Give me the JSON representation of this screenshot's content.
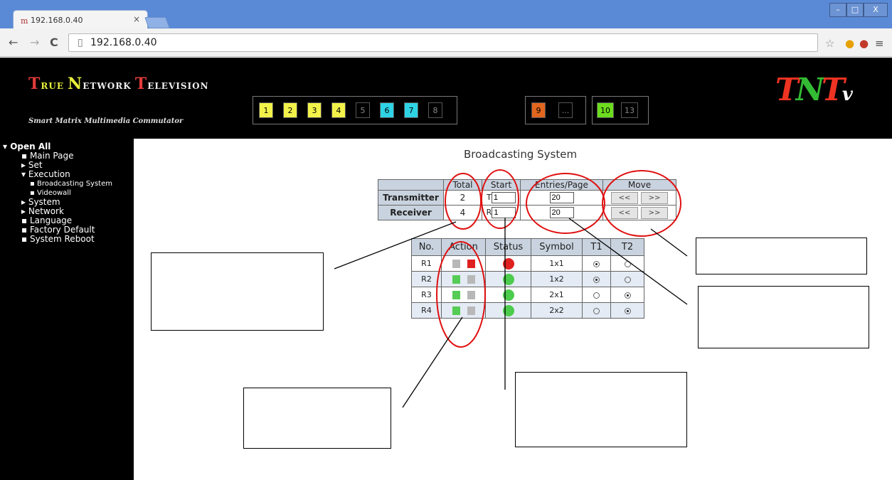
{
  "browser": {
    "tab_title": "192.168.0.40",
    "tab_close": "×",
    "url": "192.168.0.40",
    "window_controls": {
      "minimize": "–",
      "maximize": "□",
      "close": "X"
    },
    "icons": [
      "back-arrow-icon",
      "forward-arrow-icon",
      "reload-icon",
      "page-icon",
      "star-icon",
      "extension-icon",
      "extension-icon",
      "menu-icon"
    ]
  },
  "header": {
    "logo": {
      "t": "T",
      "rue": "RUE ",
      "n": "N",
      "etwork": "ETWORK ",
      "t2": "T",
      "elevision": "ELEVISION"
    },
    "subtitle": "Smart Matrix Multimedia Commutator",
    "channels_a": [
      "1",
      "2",
      "3",
      "4",
      "5",
      "6",
      "7",
      "8"
    ],
    "channels_b": [
      "9",
      "..."
    ],
    "channels_c": [
      "10",
      "13"
    ],
    "brand": {
      "t": "T",
      "n": "N",
      "t2": "T",
      "v": "v"
    }
  },
  "sidebar": {
    "items": [
      {
        "label": "▾ Open All",
        "level": 0
      },
      {
        "label": "▪ Main Page",
        "level": 1
      },
      {
        "label": "▸ Set",
        "level": 1
      },
      {
        "label": "▾ Execution",
        "level": 1
      },
      {
        "label": "▪ Broadcasting System",
        "level": 2
      },
      {
        "label": "▪ Videowall",
        "level": 2
      },
      {
        "label": "▸ System",
        "level": 1
      },
      {
        "label": "▸ Network",
        "level": 1
      },
      {
        "label": "▪ Language",
        "level": 1
      },
      {
        "label": "▪ Factory Default",
        "level": 1
      },
      {
        "label": "▪ System Reboot",
        "level": 1
      }
    ]
  },
  "main": {
    "title": "Broadcasting System",
    "summary": {
      "headers": [
        "",
        "Total",
        "Start",
        "Entries/Page",
        "Move"
      ],
      "rows": [
        {
          "label": "Transmitter",
          "total": "2",
          "prefix": "T",
          "start": "1",
          "entries": "20",
          "prev": "<<",
          "next": ">>"
        },
        {
          "label": "Receiver",
          "total": "4",
          "prefix": "R",
          "start": "1",
          "entries": "20",
          "prev": "<<",
          "next": ">>"
        }
      ]
    },
    "receivers": {
      "headers": [
        "No.",
        "Action",
        "Status",
        "Symbol",
        "T1",
        "T2"
      ],
      "rows": [
        {
          "no": "R1",
          "symbol": "1x1",
          "flag1": "#b8b8b8",
          "flag2": "#e02020",
          "status": "#e02020",
          "t1": true,
          "t2": false
        },
        {
          "no": "R2",
          "symbol": "1x2",
          "flag1": "#55cc55",
          "flag2": "#b8b8b8",
          "status": "#4ccc4c",
          "t1": true,
          "t2": false
        },
        {
          "no": "R3",
          "symbol": "2x1",
          "flag1": "#55cc55",
          "flag2": "#b8b8b8",
          "status": "#4ccc4c",
          "t1": false,
          "t2": true
        },
        {
          "no": "R4",
          "symbol": "2x2",
          "flag1": "#55cc55",
          "flag2": "#b8b8b8",
          "status": "#4ccc4c",
          "t1": false,
          "t2": true
        }
      ]
    }
  },
  "colors": {
    "channel_yellow": "#f2f24a",
    "channel_cyan": "#2ed3e6",
    "channel_orange": "#e2661e",
    "channel_green": "#6cdc1e",
    "annotation_circle": "#e01010"
  }
}
